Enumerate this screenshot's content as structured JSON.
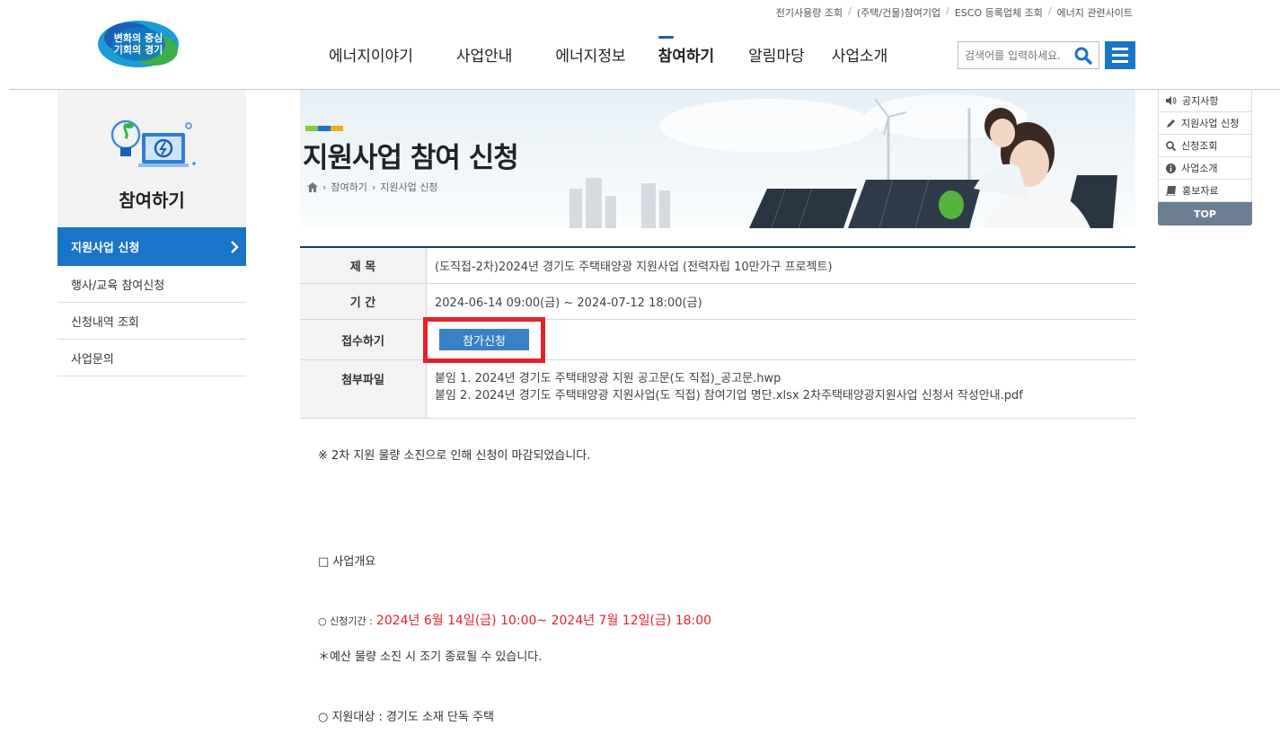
{
  "header": {
    "utility_links": [
      "전기사용량 조회",
      "(주택/건물)참여기업",
      "ESCO 등록업체 조회",
      "에너지 관련사이트"
    ],
    "logo_text_1": "변화의 중심",
    "logo_text_2": "기회의 경기",
    "nav": [
      "에너지이야기",
      "사업안내",
      "에너지정보",
      "참여하기",
      "알림마당",
      "사업소개"
    ],
    "active_nav": "참여하기",
    "search_placeholder": "검색어를 입력하세요."
  },
  "sidebar": {
    "title": "참여하기",
    "items": [
      "지원사업 신청",
      "행사/교육 참여신청",
      "신청내역 조회",
      "사업문의"
    ]
  },
  "banner": {
    "title": "지원사업 참여 신청",
    "breadcrumb": [
      "참여하기",
      "지원사업 신청"
    ],
    "color_bar": [
      "#8dc63f",
      "#1a74c8",
      "#f5a81c"
    ]
  },
  "quick_menu": {
    "items": [
      "공지사항",
      "지원사업 신청",
      "신청조회",
      "사업소개",
      "홍보자료"
    ],
    "top_label": "TOP"
  },
  "detail": {
    "subject_label": "제 목",
    "subject": "(도직접-2차)2024년 경기도 주택태양광 지원사업 (전력자립 10만가구 프로젝트)",
    "period_label": "기 간",
    "period": "2024-06-14 09:00(금) ~ 2024-07-12 18:00(금)",
    "apply_label": "접수하기",
    "apply_button": "참가신청",
    "files_label": "첨부파일",
    "files": [
      "붙임 1. 2024년 경기도 주택태양광 지원 공고문(도 직접)_공고문.hwp",
      "붙임 2. 2024년 경기도 주택태양광 지원사업(도 직접) 참여기업 명단.xlsx 2차주택태양광지원사업 신청서 작성안내.pdf"
    ]
  },
  "body": {
    "notice": "※ 2차 지원 물량 소진으로 인해 신청이 마감되었습니다.",
    "overview": "□ 사업개요",
    "period_prefix": "○ 신청기간 :",
    "period_value": "2024년 6월 14일(금) 10:00~ 2024년 7월 12일(금) 18:00",
    "early_close": "＊예산 물량 소진 시 조기 종료될 수 있습니다.",
    "target": "○ 지원대상 : 경기도 소재 단독 주택"
  }
}
